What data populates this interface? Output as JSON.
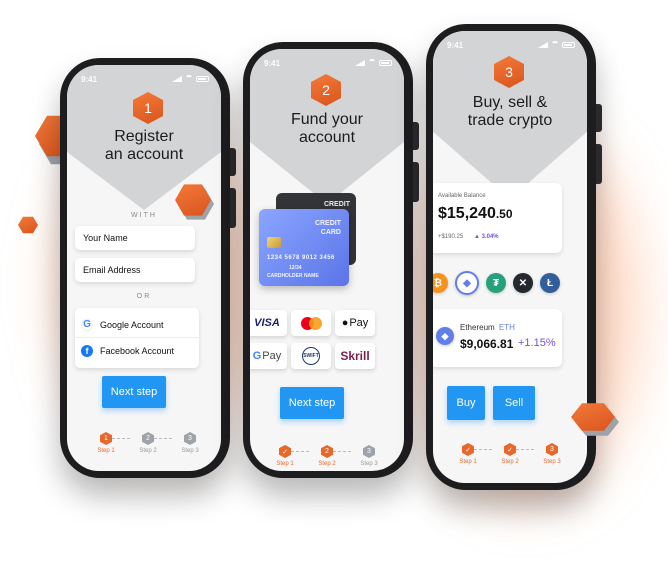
{
  "colors": {
    "accent": "#e8672a",
    "primary_button": "#2196f3",
    "positive": "#7b4fd1",
    "grey_step": "#9ea3aa"
  },
  "phone1": {
    "time": "9:41",
    "step_number": "1",
    "title_line1": "Register",
    "title_line2": "an account",
    "with_label": "WITH",
    "name_placeholder": "Your Name",
    "email_placeholder": "Email Address",
    "or_label": "OR",
    "google_label": "Google Account",
    "facebook_label": "Facebook Account",
    "next_button": "Next step",
    "steps": [
      {
        "num": "1",
        "label": "Step 1",
        "state": "active"
      },
      {
        "num": "2",
        "label": "Step 2",
        "state": "inactive"
      },
      {
        "num": "3",
        "label": "Step 3",
        "state": "inactive"
      }
    ]
  },
  "phone2": {
    "time": "9:41",
    "step_number": "2",
    "title_line1": "Fund your",
    "title_line2": "account",
    "card_front_title_1": "CREDIT",
    "card_front_title_2": "CARD",
    "card_number": "1234 5678 9012 3456",
    "card_expiry": "12/34",
    "card_holder": "CARDHOLDER NAME",
    "card_back_text": "CREDIT",
    "payment_methods": [
      "VISA",
      "Mastercard",
      "Apple Pay",
      "Google Pay",
      "SWIFT",
      "Skrill"
    ],
    "pay_labels": {
      "visa": "VISA",
      "applepay": "Pay",
      "gpay": "Pay",
      "swift": "SWIFT",
      "skrill": "Skrill"
    },
    "next_button": "Next step",
    "steps": [
      {
        "num": "✓",
        "label": "Step 1",
        "state": "done"
      },
      {
        "num": "2",
        "label": "Step 2",
        "state": "active"
      },
      {
        "num": "3",
        "label": "Step 3",
        "state": "inactive"
      }
    ]
  },
  "phone3": {
    "time": "9:41",
    "step_number": "3",
    "title_line1": "Buy, sell &",
    "title_line2": "trade crypto",
    "balance_label": "Available Balance",
    "balance_main": "$15,240",
    "balance_cents": ".50",
    "balance_change": "+$190.25",
    "balance_percent": "▲ 3.04%",
    "coins": [
      {
        "name": "bitcoin-icon",
        "glyph": "₿",
        "color": "#f7931a"
      },
      {
        "name": "ethereum-icon",
        "glyph": "◆",
        "color": "#627eea"
      },
      {
        "name": "tether-icon",
        "glyph": "₮",
        "color": "#26a17b"
      },
      {
        "name": "xrp-icon",
        "glyph": "✕",
        "color": "#23292f"
      },
      {
        "name": "litecoin-icon",
        "glyph": "Ł",
        "color": "#345d9d"
      }
    ],
    "asset_name": "Ethereum",
    "asset_ticker": "ETH",
    "asset_price": "$9,066.81",
    "asset_change": "+1.15%",
    "buy_button": "Buy",
    "sell_button": "Sell",
    "steps": [
      {
        "num": "✓",
        "label": "Step 1",
        "state": "done"
      },
      {
        "num": "✓",
        "label": "Step 2",
        "state": "done"
      },
      {
        "num": "3",
        "label": "Step 3",
        "state": "active"
      }
    ]
  }
}
